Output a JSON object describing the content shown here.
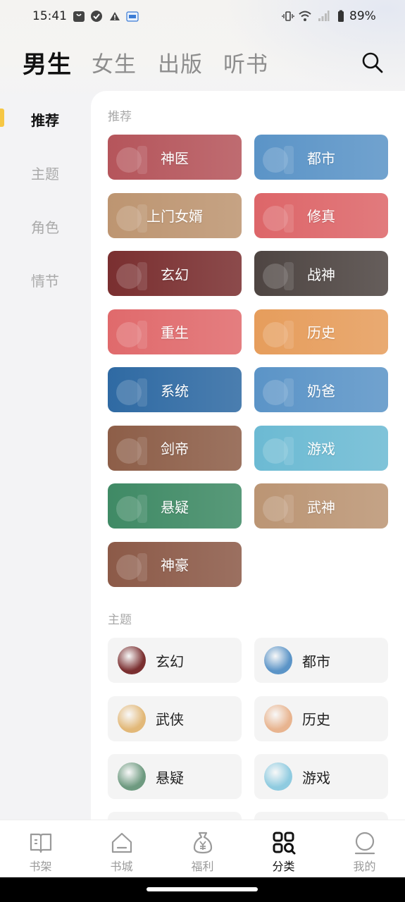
{
  "status_bar": {
    "time": "15:41",
    "battery": "89%",
    "icons": [
      "shopping-bag-icon",
      "check-circle-icon",
      "warning-icon",
      "app-badge-icon",
      "vibrate-icon",
      "wifi-icon",
      "signal-icon",
      "battery-icon"
    ]
  },
  "top_tabs": [
    {
      "label": "男生",
      "active": true
    },
    {
      "label": "女生",
      "active": false
    },
    {
      "label": "出版",
      "active": false
    },
    {
      "label": "听书",
      "active": false
    }
  ],
  "sidebar": {
    "items": [
      {
        "label": "推荐",
        "active": true
      },
      {
        "label": "主题",
        "active": false
      },
      {
        "label": "角色",
        "active": false
      },
      {
        "label": "情节",
        "active": false
      }
    ]
  },
  "recommend": {
    "title": "推荐",
    "items": [
      {
        "label": "神医",
        "color": "#b5555b"
      },
      {
        "label": "都市",
        "color": "#5b94c7"
      },
      {
        "label": "上门女婿",
        "color": "#bd9571"
      },
      {
        "label": "修真",
        "color": "#dd6669"
      },
      {
        "label": "玄幻",
        "color": "#7a2f30"
      },
      {
        "label": "战神",
        "color": "#4e4542"
      },
      {
        "label": "重生",
        "color": "#e06a6c"
      },
      {
        "label": "历史",
        "color": "#e69d5c"
      },
      {
        "label": "系统",
        "color": "#2f6aa3"
      },
      {
        "label": "奶爸",
        "color": "#5b94c7"
      },
      {
        "label": "剑帝",
        "color": "#8d5e48"
      },
      {
        "label": "游戏",
        "color": "#6cbad3"
      },
      {
        "label": "悬疑",
        "color": "#3f8a65"
      },
      {
        "label": "武神",
        "color": "#bb9574"
      },
      {
        "label": "神豪",
        "color": "#8c5a48"
      }
    ]
  },
  "themes": {
    "title": "主题",
    "items": [
      {
        "label": "玄幻",
        "color": "#7a2f30"
      },
      {
        "label": "都市",
        "color": "#5b94c7"
      },
      {
        "label": "武侠",
        "color": "#e2b878"
      },
      {
        "label": "历史",
        "color": "#e8b48f"
      },
      {
        "label": "悬疑",
        "color": "#6e9a80"
      },
      {
        "label": "游戏",
        "color": "#8fcbe0"
      }
    ]
  },
  "bottom_nav": [
    {
      "label": "书架",
      "icon": "bookshelf-icon",
      "active": false
    },
    {
      "label": "书城",
      "icon": "bookstore-icon",
      "active": false
    },
    {
      "label": "福利",
      "icon": "money-bag-icon",
      "active": false
    },
    {
      "label": "分类",
      "icon": "category-icon",
      "active": true
    },
    {
      "label": "我的",
      "icon": "profile-icon",
      "active": false
    }
  ]
}
